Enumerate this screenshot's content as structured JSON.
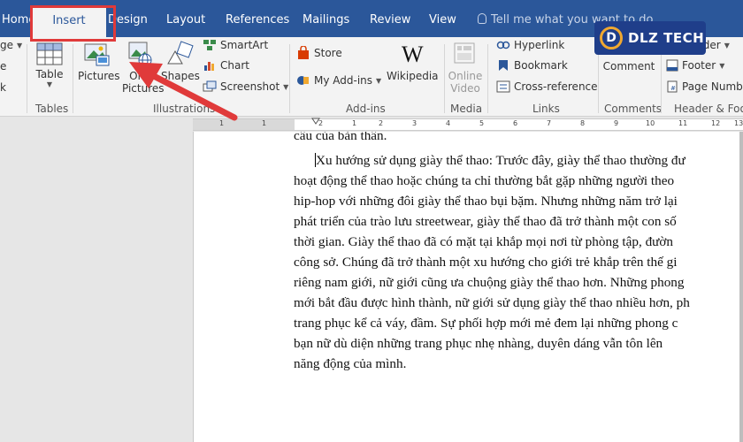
{
  "tabs": [
    {
      "label": "Home"
    },
    {
      "label": "Insert",
      "active": true
    },
    {
      "label": "Design"
    },
    {
      "label": "Layout"
    },
    {
      "label": "References"
    },
    {
      "label": "Mailings"
    },
    {
      "label": "Review"
    },
    {
      "label": "View"
    }
  ],
  "tell_me": "Tell me what you want to do",
  "ribbon": {
    "left_partial": [
      "ge",
      "e",
      "k"
    ],
    "tables": {
      "table_label": "Table",
      "group": "Tables"
    },
    "illustrations": {
      "pictures": "Pictures",
      "online_pictures_1": "Onli",
      "online_pictures_2": "Pictures",
      "shapes": "Shapes",
      "smartart": "SmartArt",
      "chart": "Chart",
      "screenshot": "Screenshot",
      "group": "Illustrations"
    },
    "addins": {
      "store": "Store",
      "my_addins": "My Add-ins",
      "wikipedia": "Wikipedia",
      "group": "Add-ins"
    },
    "media": {
      "online_video_1": "Online",
      "online_video_2": "Video",
      "group": "Media"
    },
    "links": {
      "hyperlink": "Hyperlink",
      "bookmark": "Bookmark",
      "cross_reference": "Cross-reference",
      "group": "Links"
    },
    "comments": {
      "comment": "Comment",
      "group": "Comments"
    },
    "header_footer": {
      "header": "Header",
      "footer": "Footer",
      "page_number": "Page Numb",
      "group": "Header & Foot"
    }
  },
  "logo": {
    "text": "DLZ TECH",
    "letter": "D"
  },
  "ruler": {
    "labels": [
      "1",
      "1",
      "2",
      "1",
      "2",
      "3",
      "4",
      "5",
      "6",
      "7",
      "8",
      "9",
      "10",
      "11",
      "12",
      "13"
    ]
  },
  "document": {
    "lines": [
      "câu của bản thân.",
      "Xu hướng sử dụng giày thể thao: Trước đây, giày thể thao thường đư",
      "hoạt động thể thao hoặc chúng ta chỉ thường bắt gặp những người theo",
      "hip-hop với những đôi giày thể thao bụi bặm. Nhưng những năm trở lại",
      "phát triển của trào lưu streetwear, giày thể thao đã trở thành một con số",
      "thời gian. Giày thể thao đã có mặt tại khắp mọi nơi từ phòng tập, đườn",
      "công sở. Chúng đã trở thành một xu hướng cho giới trẻ khắp trên thế gi",
      "riêng nam giới, nữ giới cũng ưa chuộng giày thể thao hơn. Những phong",
      "mới bắt đầu được hình thành, nữ giới sử dụng giày thể thao nhiều hơn, ph",
      "trang phục kể cả váy, đầm. Sự phối hợp mới mẻ đem lại những phong c",
      "bạn nữ dù diện những trang phục nhẹ nhàng, duyên dáng vẫn tôn lên",
      "năng động của mình."
    ]
  },
  "colors": {
    "accent": "#2b579a",
    "highlight": "#e03a3a"
  }
}
